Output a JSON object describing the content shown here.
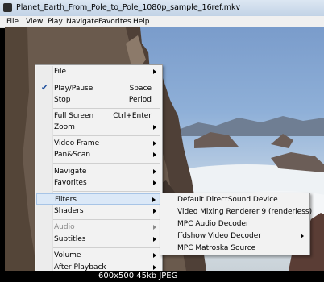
{
  "window": {
    "title": "Planet_Earth_From_Pole_to_Pole_1080p_sample_16ref.mkv"
  },
  "menubar": [
    "File",
    "View",
    "Play",
    "Navigate",
    "Favorites",
    "Help"
  ],
  "context_menu": {
    "items": [
      {
        "label": "File",
        "submenu": true
      },
      {
        "label": "Play/Pause",
        "shortcut": "Space",
        "checked": true
      },
      {
        "label": "Stop",
        "shortcut": "Period"
      },
      {
        "label": "Full Screen",
        "shortcut": "Ctrl+Enter"
      },
      {
        "label": "Zoom",
        "submenu": true
      },
      {
        "label": "Video Frame",
        "submenu": true
      },
      {
        "label": "Pan&Scan",
        "submenu": true
      },
      {
        "label": "Navigate",
        "submenu": true
      },
      {
        "label": "Favorites",
        "submenu": true
      },
      {
        "label": "Filters",
        "submenu": true,
        "highlighted": true
      },
      {
        "label": "Shaders",
        "submenu": true
      },
      {
        "label": "Audio",
        "submenu": true,
        "disabled": true
      },
      {
        "label": "Subtitles",
        "submenu": true
      },
      {
        "label": "Volume",
        "submenu": true
      },
      {
        "label": "After Playback",
        "submenu": true
      }
    ]
  },
  "filters_submenu": {
    "items": [
      {
        "label": "Default DirectSound Device"
      },
      {
        "label": "Video Mixing Renderer 9 (renderless)"
      },
      {
        "label": "MPC Audio Decoder"
      },
      {
        "label": "ffdshow Video Decoder",
        "submenu": true
      },
      {
        "label": "MPC Matroska Source"
      }
    ]
  },
  "status_caption": "600x500 45kb JPEG",
  "colors": {
    "menu_bg": "#f2f2f2",
    "highlight": "#dbe8f7",
    "check": "#1c4d9c"
  }
}
